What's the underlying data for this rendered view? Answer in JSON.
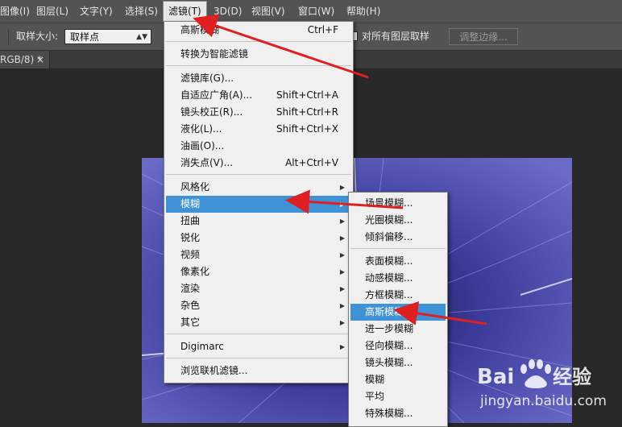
{
  "menubar": {
    "items": [
      "图像(I)",
      "图层(L)",
      "文字(Y)",
      "选择(S)",
      "滤镜(T)",
      "3D(D)",
      "视图(V)",
      "窗口(W)",
      "帮助(H)"
    ],
    "active_index": 4
  },
  "options": {
    "sample_size_label": "取样大小:",
    "sample_size_value": "取样点",
    "sample_all_layers_label": "对所有图层取样",
    "refine_edge_label": "调整边缘..."
  },
  "document": {
    "tab_label": "RGB/8) *",
    "close_glyph": "×"
  },
  "filter_menu": {
    "items": [
      {
        "label": "高斯模糊",
        "shortcut": "Ctrl+F"
      },
      {
        "label": "转换为智能滤镜",
        "shortcut": ""
      },
      {
        "label": "滤镜库(G)...",
        "shortcut": ""
      },
      {
        "label": "自适应广角(A)...",
        "shortcut": "Shift+Ctrl+A"
      },
      {
        "label": "镜头校正(R)...",
        "shortcut": "Shift+Ctrl+R"
      },
      {
        "label": "液化(L)...",
        "shortcut": "Shift+Ctrl+X"
      },
      {
        "label": "油画(O)...",
        "shortcut": ""
      },
      {
        "label": "消失点(V)...",
        "shortcut": "Alt+Ctrl+V"
      },
      {
        "label": "风格化",
        "shortcut": ""
      },
      {
        "label": "模糊",
        "shortcut": ""
      },
      {
        "label": "扭曲",
        "shortcut": ""
      },
      {
        "label": "锐化",
        "shortcut": ""
      },
      {
        "label": "视频",
        "shortcut": ""
      },
      {
        "label": "像素化",
        "shortcut": ""
      },
      {
        "label": "渲染",
        "shortcut": ""
      },
      {
        "label": "杂色",
        "shortcut": ""
      },
      {
        "label": "其它",
        "shortcut": ""
      },
      {
        "label": "Digimarc",
        "shortcut": ""
      },
      {
        "label": "浏览联机滤镜...",
        "shortcut": ""
      }
    ],
    "highlighted": "模糊"
  },
  "blur_submenu": {
    "items": [
      "场景模糊...",
      "光圈模糊...",
      "倾斜偏移...",
      "表面模糊...",
      "动感模糊...",
      "方框模糊...",
      "高斯模糊...",
      "进一步模糊",
      "径向模糊...",
      "镜头模糊...",
      "模糊",
      "平均",
      "特殊模糊..."
    ],
    "highlighted": "高斯模糊..."
  },
  "watermark": {
    "brand": "Baidu",
    "site": "jingyan.baidu.com"
  },
  "colors": {
    "menu_highlight": "#3f92d6",
    "annotation_arrow": "#e02020",
    "canvas_tint": "#2a2a6e"
  }
}
